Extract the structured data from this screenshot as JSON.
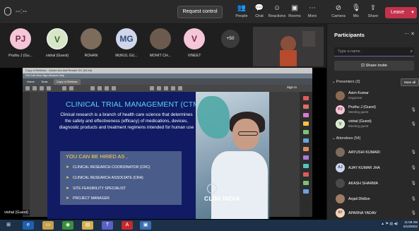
{
  "topbar": {
    "timer": "--:--",
    "request_control": "Request control",
    "controls": [
      {
        "label": "People",
        "icon": "people-icon"
      },
      {
        "label": "Chat",
        "icon": "chat-icon"
      },
      {
        "label": "Reactions",
        "icon": "reactions-icon"
      },
      {
        "label": "Rooms",
        "icon": "rooms-icon"
      },
      {
        "label": "More",
        "icon": "more-icon"
      },
      {
        "label": "Camera",
        "icon": "camera-off-icon"
      },
      {
        "label": "Mic",
        "icon": "mic-off-icon"
      },
      {
        "label": "Share",
        "icon": "share-icon"
      }
    ],
    "leave": "Leave"
  },
  "gallery": [
    {
      "initials": "PJ",
      "name": "Pruthu J (Gu...",
      "bg": "#f4c6d7",
      "fg": "#7b2a4a"
    },
    {
      "initials": "V",
      "name": "vishal (Guest)",
      "bg": "#d7e6c8",
      "fg": "#3f5e24"
    },
    {
      "initials": "",
      "name": "ROHAN",
      "bg": "#7d6b5c",
      "fg": "#fff"
    },
    {
      "initials": "MG",
      "name": "MUKUL GU...",
      "bg": "#cfd6ea",
      "fg": "#334a7a"
    },
    {
      "initials": "",
      "name": "MOHIT CH...",
      "bg": "#6c5a4f",
      "fg": "#fff"
    },
    {
      "initials": "V",
      "name": "VINEET",
      "bg": "#f4c6d7",
      "fg": "#7b2a4a"
    }
  ],
  "gallery_more": "+50",
  "screen_share": {
    "window_title": "Copy of Webinar - Adobe Acrobat Reader DC (64-bit)",
    "menu": "File  Edit  View  Sign  Window  Help",
    "tabs": [
      "Home",
      "Tools",
      "Copy of Webinar"
    ],
    "sign_in": "Sign In",
    "self_label": "vishal (Guest)"
  },
  "slide": {
    "title": "CLINICAL TRIAL MANAGEMENT (CTM)",
    "body": "Clinical research is a branch of health care science that determines the safety and effectiveness (efficacy) of medications, devices, diagnostic products and treatment regimens intended for human use",
    "hire_title": "YOU CAN BE HIRED AS ,",
    "roles": [
      "CLINICAL RESEARCH COORDINATOR (CRC)",
      "CLINICAL RESEARCH ASSOCIATE (CRA)",
      "SITE FEASIBILITY SPECIALIST",
      "PROJECT MANAGER"
    ],
    "brand": "CLINI INDIA"
  },
  "participants": {
    "title": "Participants",
    "search_placeholder": "Type a name",
    "share_invite": "Share invite",
    "presenters_header": "Presenters (3)",
    "mute_all": "Mute all",
    "presenters": [
      {
        "initials": "",
        "name": "Asim Kumar",
        "role": "Organizer",
        "bg": "#8a6b52",
        "fg": "#fff"
      },
      {
        "initials": "PJ",
        "name": "Pruthu J (Guest)",
        "role": "Meeting guest",
        "bg": "#f4c6d7",
        "fg": "#7b2a4a"
      },
      {
        "initials": "V",
        "name": "vishal (Guest)",
        "role": "Meeting guest",
        "bg": "#d7e6c8",
        "fg": "#3f5e24"
      }
    ],
    "attendees_header": "Attendees (54)",
    "attendees": [
      {
        "initials": "",
        "name": "AAYUSHI KUMARI",
        "bg": "#7d6b5c",
        "fg": "#fff"
      },
      {
        "initials": "AJ",
        "name": "AJAY KUMAR JHA",
        "bg": "#cfd6ea",
        "fg": "#334a7a"
      },
      {
        "initials": "",
        "name": "AKASH SHARMA",
        "bg": "#4a4a4a",
        "fg": "#fff"
      },
      {
        "initials": "",
        "name": "Anjali Dhillon",
        "bg": "#a07c66",
        "fg": "#fff"
      },
      {
        "initials": "AY",
        "name": "APARNA YADAV",
        "bg": "#f1d4c0",
        "fg": "#8a4b25"
      }
    ]
  },
  "taskbar": {
    "apps": [
      {
        "icon": "windows-start-icon",
        "glyph": "⊞",
        "bg": "#1c3048"
      },
      {
        "icon": "internet-explorer-icon",
        "glyph": "e",
        "bg": "#1e5fb0"
      },
      {
        "icon": "file-explorer-icon",
        "glyph": "▭",
        "bg": "#c7a24a"
      },
      {
        "icon": "chrome-icon",
        "glyph": "◉",
        "bg": "#3a8f3a"
      },
      {
        "icon": "folder-icon",
        "glyph": "▤",
        "bg": "#d4b14a"
      },
      {
        "icon": "teams-icon",
        "glyph": "T",
        "bg": "#5b5fc7"
      },
      {
        "icon": "acrobat-icon",
        "glyph": "A",
        "bg": "#c8282c"
      },
      {
        "icon": "photo-icon",
        "glyph": "▣",
        "bg": "#3b6fb3"
      }
    ],
    "clock_time": "11:08 AM",
    "clock_date": "5/13/2022"
  },
  "colors": {
    "leave": "#c4314b",
    "slide_bg": "#101b63",
    "slide_title": "#5fd2f0",
    "hire_title": "#ffd94a",
    "taskbar": "#1c3048"
  }
}
